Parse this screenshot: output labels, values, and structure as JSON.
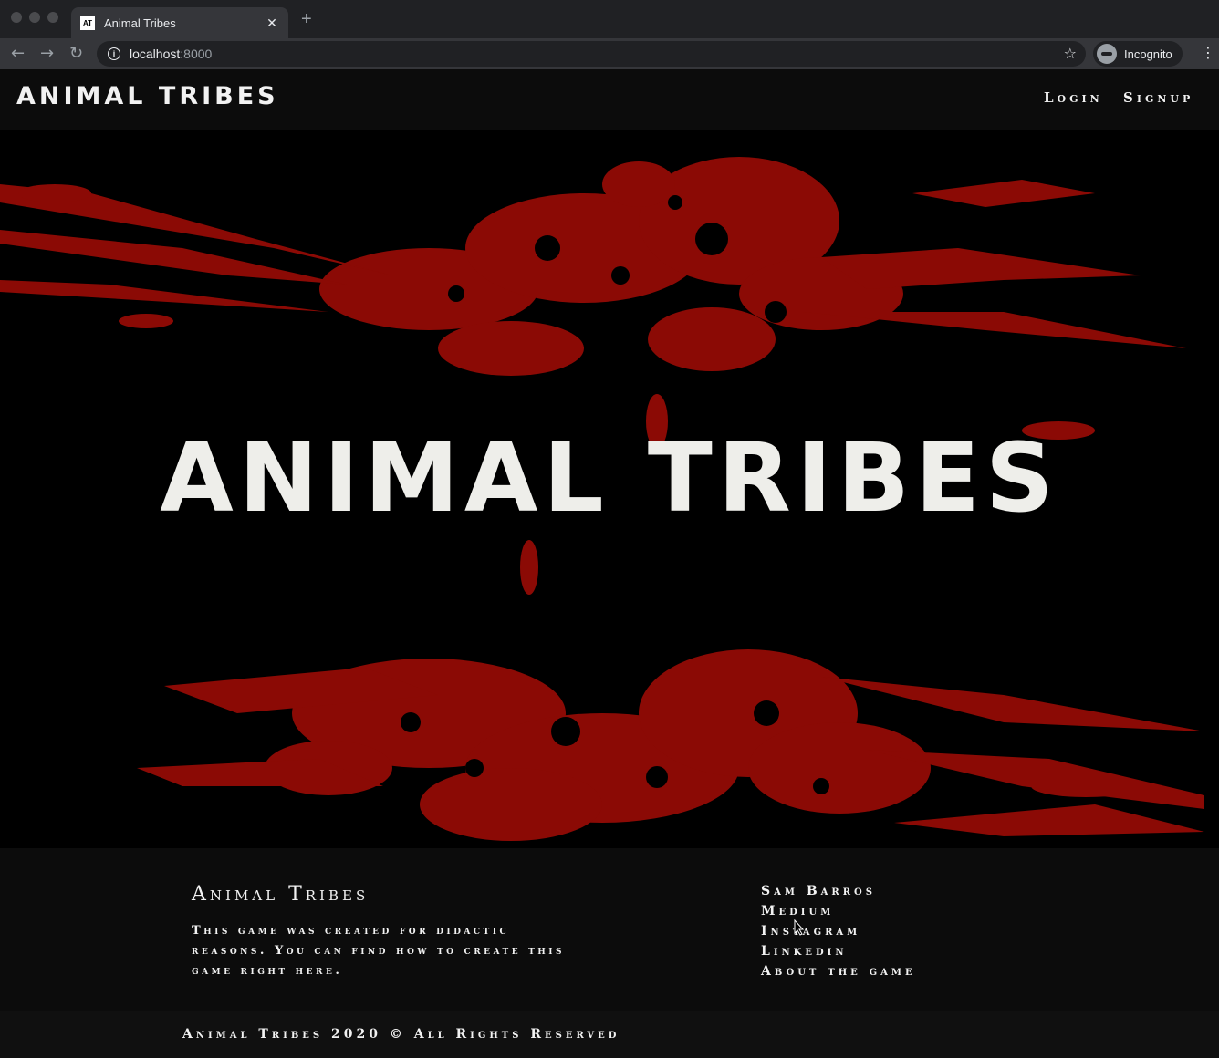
{
  "browser": {
    "tab_title": "Animal Tribes",
    "favicon_text": "AT",
    "url_host": "localhost",
    "url_port": ":8000",
    "profile_label": "Incognito",
    "icons": [
      "back-icon",
      "forward-icon",
      "reload-icon",
      "info-icon",
      "star-icon",
      "incognito-icon",
      "menu-icon",
      "close-icon",
      "plus-icon"
    ]
  },
  "header": {
    "logo": "Animal Tribes",
    "nav": {
      "login": "Login",
      "signup": "Signup"
    }
  },
  "hero": {
    "title": "Animal Tribes",
    "accent_color": "#8b0a05"
  },
  "footer": {
    "title": "Animal Tribes",
    "description": "This game was created for didactic reasons. You can find how to create this game right here.",
    "links": [
      "Sam Barros",
      "Medium",
      "Instagram",
      "Linkedin",
      "About the game"
    ],
    "copyright": "Animal Tribes 2020 © All Rights Reserved"
  }
}
